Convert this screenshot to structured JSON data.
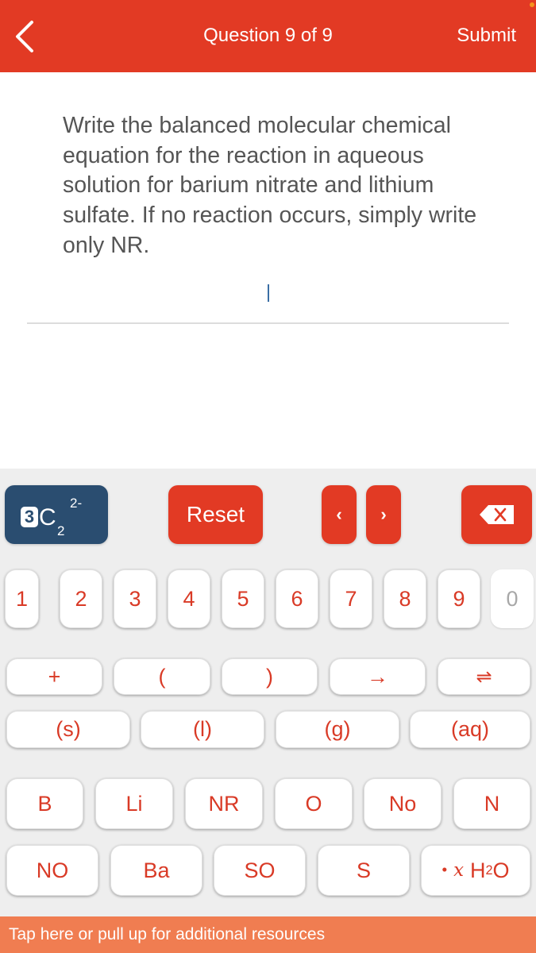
{
  "header": {
    "title": "Question 9 of 9",
    "submit_label": "Submit",
    "back_icon": "chevron-left-icon",
    "background_color": "#e23a24"
  },
  "question": {
    "text": "Write the balanced molecular chemical equation for the reaction in aqueous solution for barium nitrate and lithium sulfate. If no reaction occurs, simply write only NR."
  },
  "answer": {
    "value": ""
  },
  "toolbar": {
    "mode_button": {
      "coefficient": "3",
      "element": "C",
      "subscript": "2",
      "superscript": "2-"
    },
    "reset_label": "Reset",
    "cursor_left_label": "‹",
    "cursor_right_label": "›",
    "delete_icon": "backspace-icon"
  },
  "keypad": {
    "digits": [
      "1",
      "2",
      "3",
      "4",
      "5",
      "6",
      "7",
      "8",
      "9",
      "0"
    ],
    "disabled_digits": [
      "0"
    ],
    "symbols": [
      "+",
      "(",
      ")",
      "→",
      "⇌"
    ],
    "states": [
      "(s)",
      "(l)",
      "(g)",
      "(aq)"
    ],
    "elements_row1": [
      "B",
      "Li",
      "NR",
      "O",
      "No",
      "N"
    ],
    "elements_row2": [
      "NO",
      "Ba",
      "SO",
      "S"
    ],
    "hydrate": {
      "dot": "•",
      "var": "x",
      "formula_main": "H",
      "formula_sub": "2",
      "formula_end": "O"
    }
  },
  "footer": {
    "text": "Tap here or pull up for additional resources"
  },
  "colors": {
    "accent_red": "#e23a24",
    "key_text": "#d93a26",
    "mode_blue": "#2a4d70",
    "footer_orange": "#f07d51"
  }
}
